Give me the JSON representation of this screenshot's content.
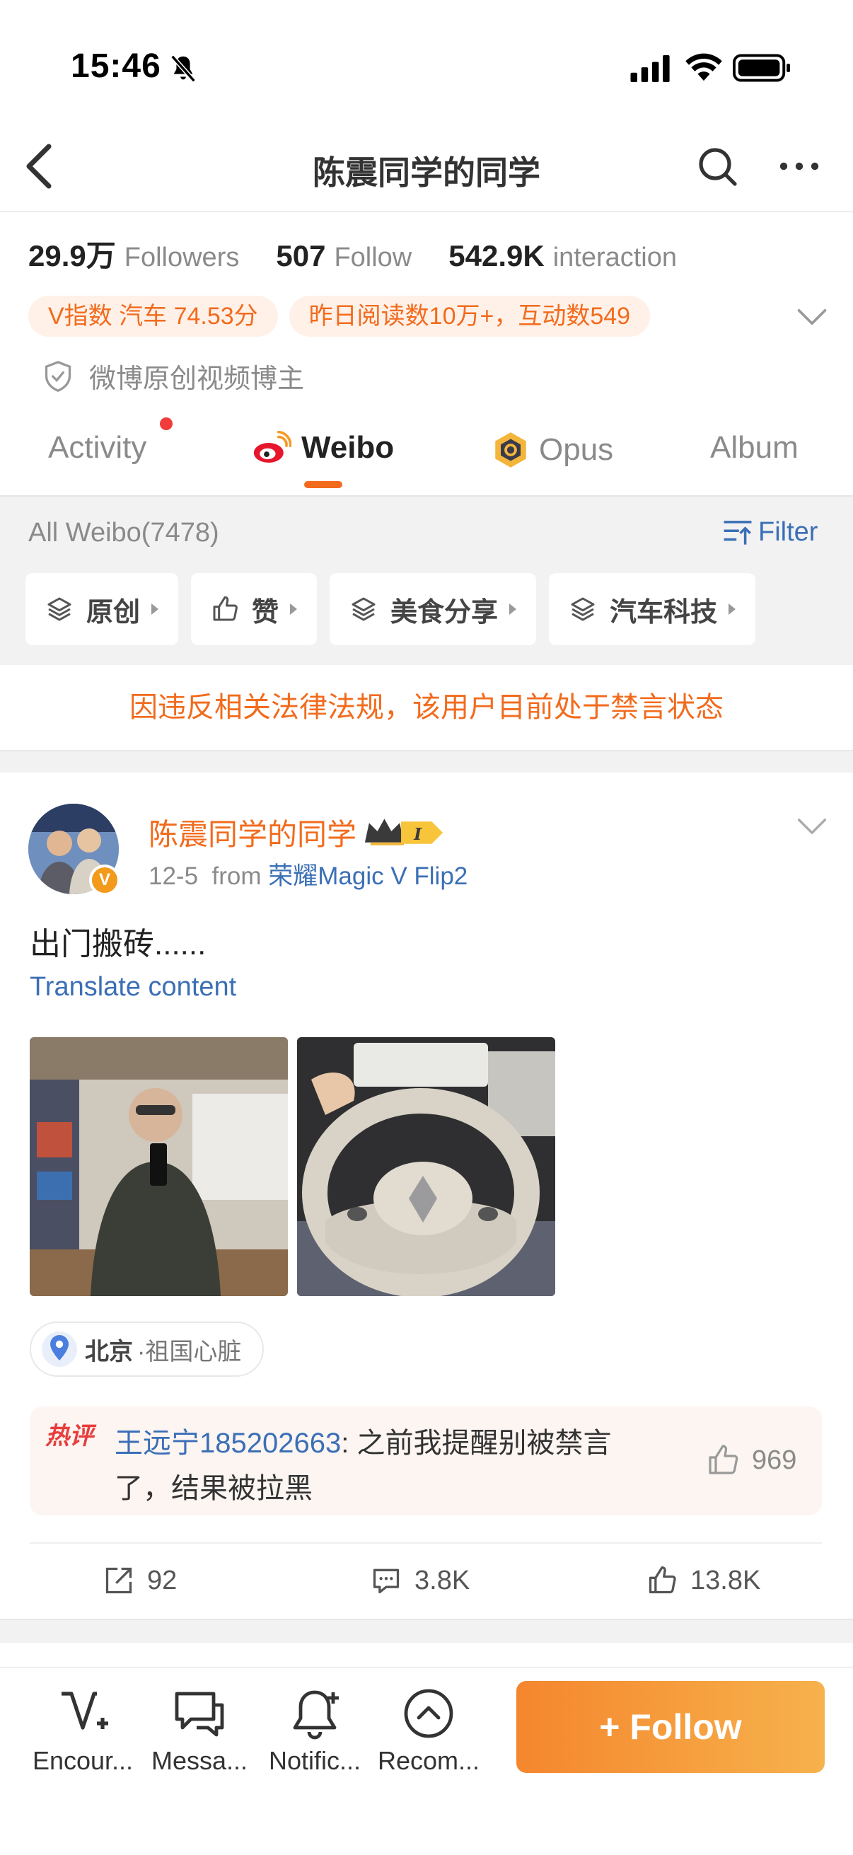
{
  "status_bar": {
    "time": "15:46"
  },
  "nav": {
    "title": "陈震同学的同学"
  },
  "stats": [
    {
      "value": "29.9万",
      "label": "Followers"
    },
    {
      "value": "507",
      "label": "Follow"
    },
    {
      "value": "542.9K",
      "label": "interaction"
    }
  ],
  "tags": [
    "V指数 汽车 74.53分",
    "昨日阅读数10万+，互动数549"
  ],
  "verify_label": "微博原创视频博主",
  "tabs": [
    {
      "label": "Activity"
    },
    {
      "label": "Weibo"
    },
    {
      "label": "Opus"
    },
    {
      "label": "Album"
    }
  ],
  "weibo_list": {
    "title": "All Weibo(7478)",
    "filter_label": "Filter",
    "chips": [
      "原创",
      "赞",
      "美食分享",
      "汽车科技"
    ]
  },
  "banned_notice": "因违反相关法律法规，该用户目前处于禁言状态",
  "post": {
    "author": "陈震同学的同学",
    "avatar_badge": "V",
    "date": "12-5",
    "from": "from",
    "device": "荣耀Magic V Flip2",
    "text": "出门搬砖......",
    "translate": "Translate content",
    "location_city": "北京",
    "location_sub": "·祖国心脏",
    "hot_comment": {
      "badge": "热评",
      "user": "王远宁185202663",
      "text": ": 之前我提醒别被禁言了，结果被拉黑",
      "likes": "969"
    },
    "reposts": "92",
    "comments": "3.8K",
    "likes": "13.8K"
  },
  "bottom_bar": {
    "items": [
      "Encour...",
      "Messa...",
      "Notific...",
      "Recom..."
    ],
    "follow": "+ Follow"
  },
  "colors": {
    "accent": "#f26b1d",
    "link": "#3b6fb6",
    "follow_gradient_start": "#f5862e",
    "follow_gradient_end": "#f6b24c"
  }
}
